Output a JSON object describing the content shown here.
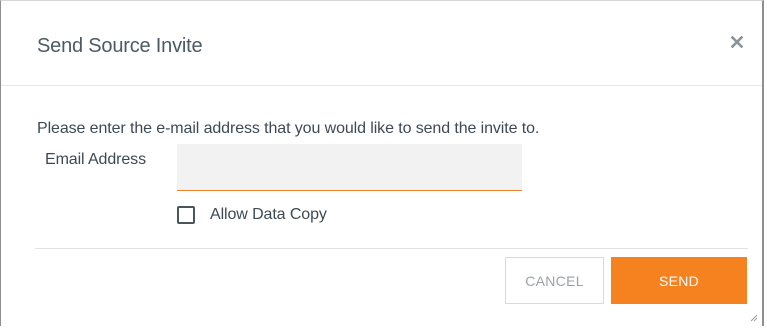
{
  "dialog": {
    "title": "Send Source Invite",
    "close_icon": "close-icon",
    "prompt": "Please enter the e-mail address that you would like to send the invite to.",
    "email": {
      "label": "Email Address",
      "value": "",
      "placeholder": ""
    },
    "allow_data_copy": {
      "label": "Allow Data Copy",
      "checked": false
    },
    "buttons": {
      "cancel_label": "CANCEL",
      "send_label": "SEND"
    }
  },
  "colors": {
    "accent": "#f5811f",
    "text": "#3d4a56",
    "input_bg": "#f2f2f2"
  }
}
